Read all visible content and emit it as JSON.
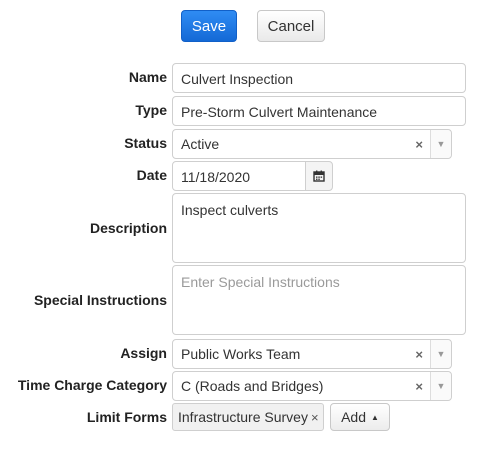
{
  "toolbar": {
    "save_label": "Save",
    "cancel_label": "Cancel"
  },
  "form": {
    "name": {
      "label": "Name",
      "value": "Culvert Inspection"
    },
    "type": {
      "label": "Type",
      "value": "Pre-Storm Culvert Maintenance"
    },
    "status": {
      "label": "Status",
      "value": "Active"
    },
    "date": {
      "label": "Date",
      "value": "11/18/2020"
    },
    "description": {
      "label": "Description",
      "value": "Inspect culverts"
    },
    "special_instructions": {
      "label": "Special Instructions",
      "placeholder": "Enter Special Instructions"
    },
    "assign": {
      "label": "Assign",
      "value": "Public Works Team"
    },
    "time_charge_category": {
      "label": "Time Charge Category",
      "value": "C (Roads and Bridges)"
    },
    "limit_forms": {
      "label": "Limit Forms",
      "tags": [
        "Infrastructure Survey"
      ],
      "add_label": "Add"
    }
  },
  "icons": {
    "clear": "×",
    "dropdown": "▼",
    "calendar": "calendar-icon",
    "caret_up": "▲"
  },
  "colors": {
    "primary": "#1a73e8",
    "border": "#cfcfcf"
  }
}
